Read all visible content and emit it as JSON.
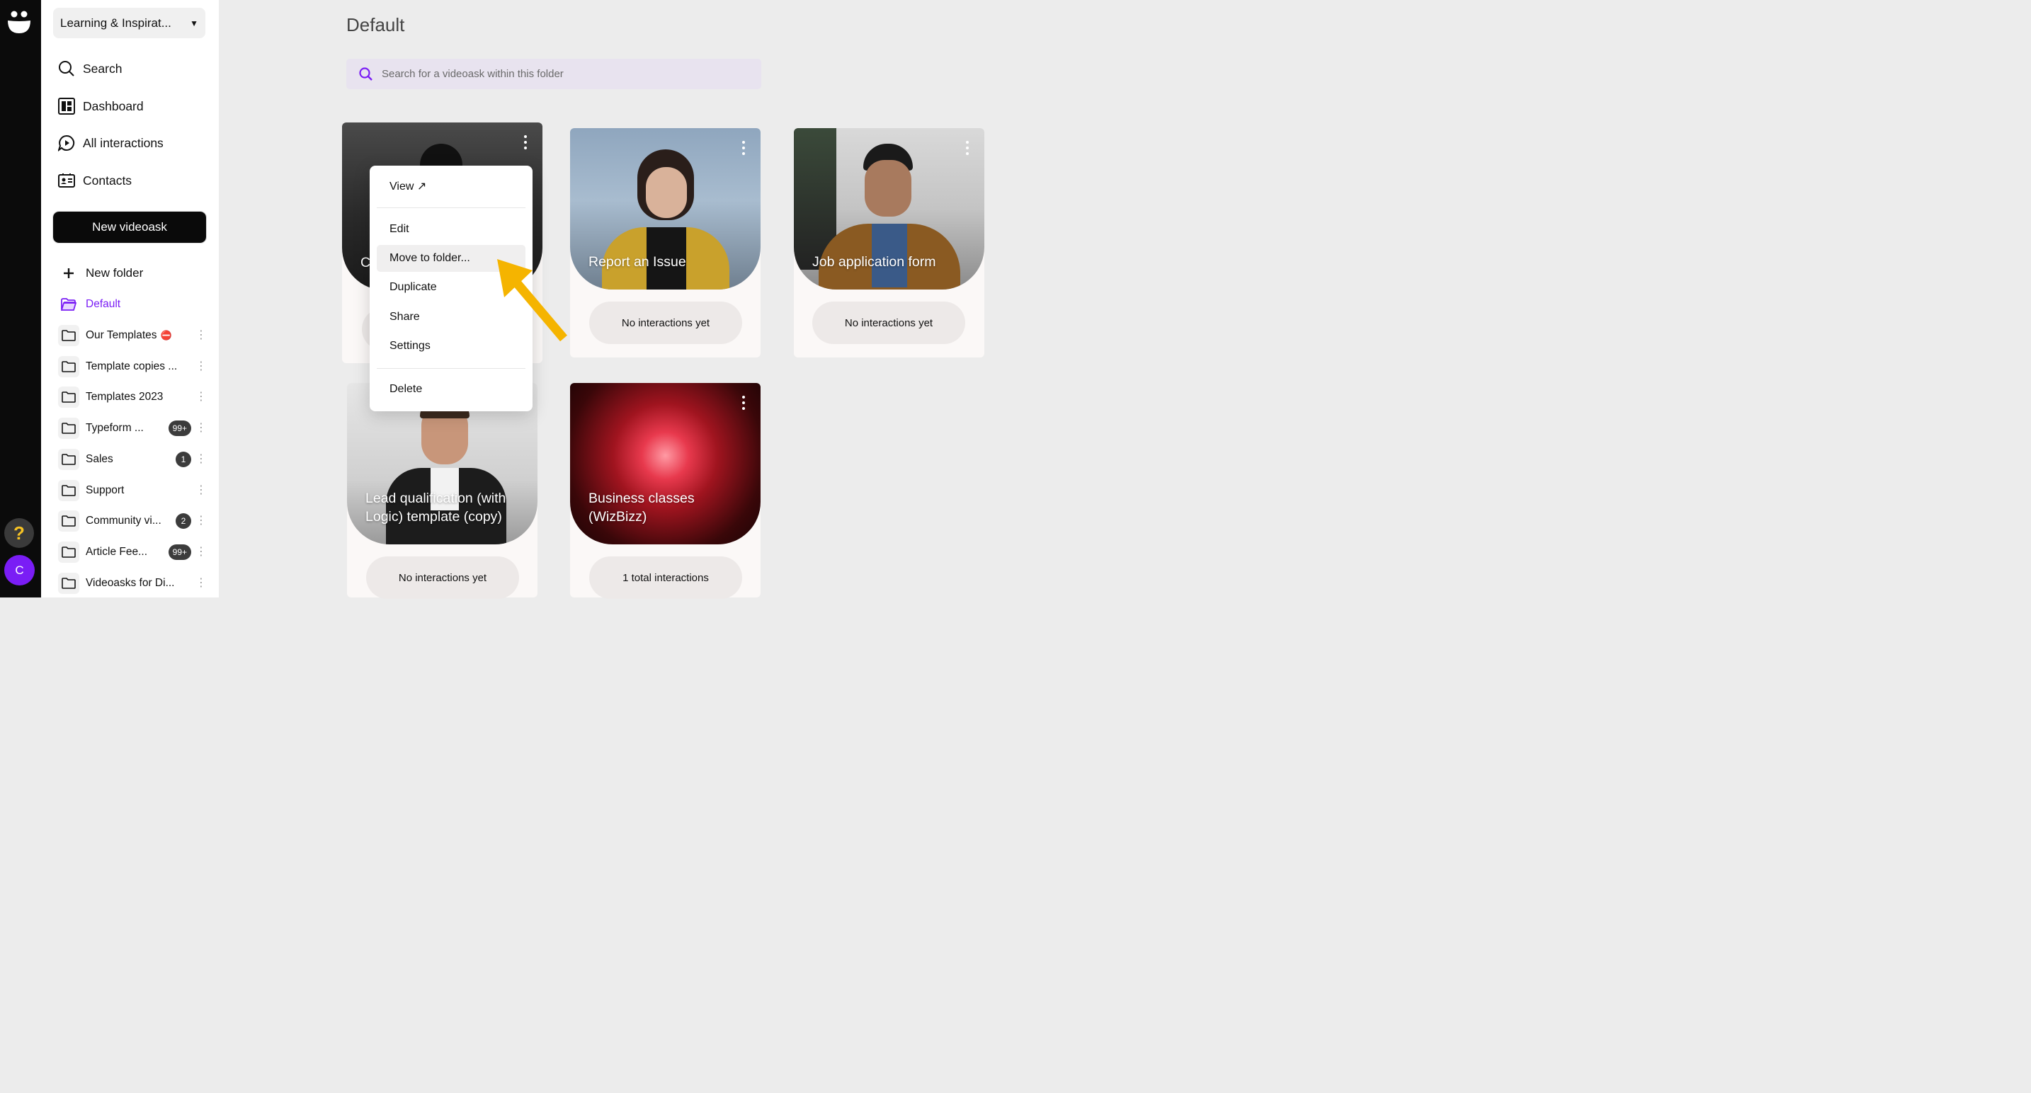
{
  "workspace": {
    "name": "Learning & Inspirat..."
  },
  "nav": [
    {
      "label": "Search",
      "icon": "search-icon"
    },
    {
      "label": "Dashboard",
      "icon": "dashboard-icon"
    },
    {
      "label": "All interactions",
      "icon": "chat-bubble-icon"
    },
    {
      "label": "Contacts",
      "icon": "contact-card-icon"
    }
  ],
  "new_videoask_label": "New videoask",
  "new_folder_label": "New folder",
  "folders": [
    {
      "name": "Default",
      "active": true
    },
    {
      "name": "Our Templates",
      "emoji": "⛔"
    },
    {
      "name": "Template copies ..."
    },
    {
      "name": "Templates 2023"
    },
    {
      "name": "Typeform ...",
      "badge": "99+"
    },
    {
      "name": "Sales",
      "badge": "1"
    },
    {
      "name": "Support"
    },
    {
      "name": "Community vi...",
      "badge": "2"
    },
    {
      "name": "Article Fee...",
      "badge": "99+"
    },
    {
      "name": "Videoasks for Di..."
    }
  ],
  "rail": {
    "help_label": "?",
    "avatar_initial": "C"
  },
  "main": {
    "title": "Default",
    "search_placeholder": "Search for a videoask within this folder"
  },
  "cards": [
    {
      "title": "C",
      "stats": ""
    },
    {
      "title": "Report an Issue",
      "stats": "No interactions yet"
    },
    {
      "title": "Job application form",
      "stats": "No interactions yet"
    },
    {
      "title": "Lead qualification (with Logic) template (copy)",
      "stats": "No interactions yet"
    },
    {
      "title": "Business classes (WizBizz)",
      "stats": "1 total interactions"
    }
  ],
  "context_menu": {
    "items": [
      "View ↗",
      "Edit",
      "Move to folder...",
      "Duplicate",
      "Share",
      "Settings",
      "Delete"
    ],
    "highlighted": "Move to folder..."
  },
  "colors": {
    "accent": "#7a1df5",
    "arrow": "#f5b400",
    "rail": "#0b0b0b"
  }
}
